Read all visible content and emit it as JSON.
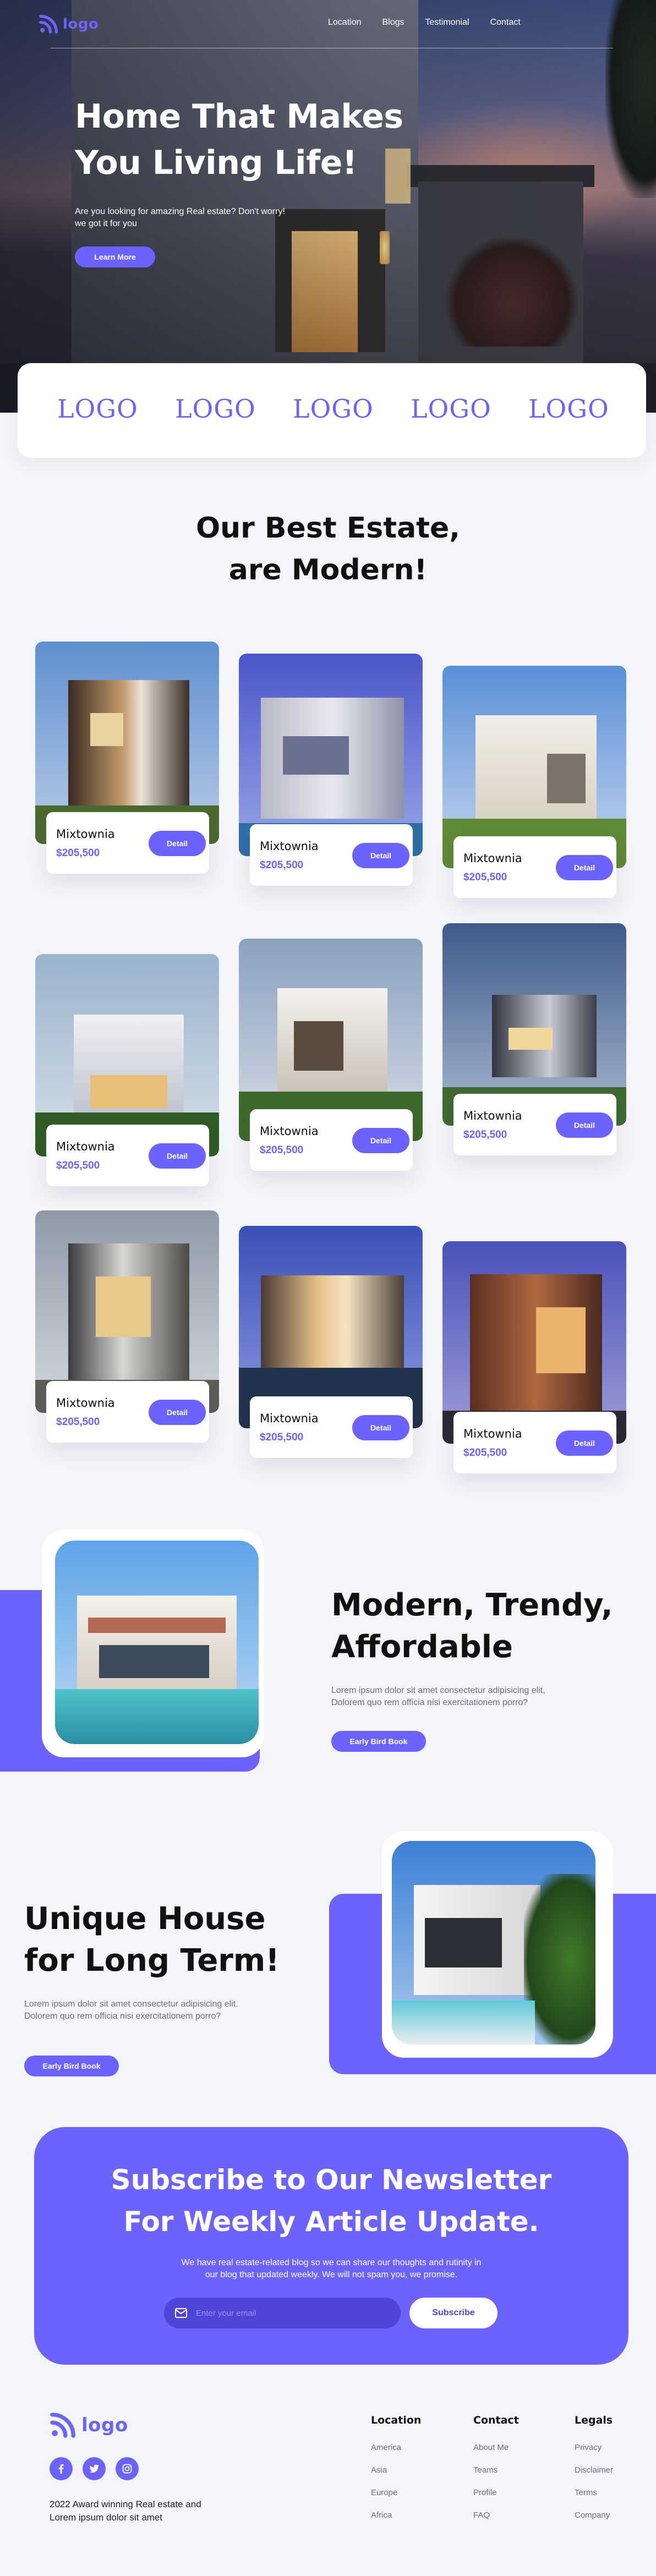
{
  "brand": {
    "name": "logo",
    "accent": "#6c63ff"
  },
  "nav": {
    "items": [
      "Location",
      "Blogs",
      "Testimonial",
      "Contact"
    ]
  },
  "hero": {
    "title_line1": "Home That Makes",
    "title_line2": "You Living Life!",
    "subtitle": "Are you looking for amazing Real estate? Don't worry! we got it for you",
    "cta": "Learn More"
  },
  "partners": [
    "LOGO",
    "LOGO",
    "LOGO",
    "LOGO",
    "LOGO"
  ],
  "estates": {
    "title_line1": "Our Best Estate,",
    "title_line2": "are Modern!",
    "cards": [
      {
        "name": "Mixtownia",
        "price": "$205,500",
        "button": "Detail"
      },
      {
        "name": "Mixtownia",
        "price": "$205,500",
        "button": "Detail"
      },
      {
        "name": "Mixtownia",
        "price": "$205,500",
        "button": "Detail"
      },
      {
        "name": "Mixtownia",
        "price": "$205,500",
        "button": "Detail"
      },
      {
        "name": "Mixtownia",
        "price": "$205,500",
        "button": "Detail"
      },
      {
        "name": "Mixtownia",
        "price": "$205,500",
        "button": "Detail"
      },
      {
        "name": "Mixtownia",
        "price": "$205,500",
        "button": "Detail"
      },
      {
        "name": "Mixtownia",
        "price": "$205,500",
        "button": "Detail"
      },
      {
        "name": "Mixtownia",
        "price": "$205,500",
        "button": "Detail"
      }
    ]
  },
  "feature1": {
    "title_line1": "Modern, Trendy,",
    "title_line2": "Affordable",
    "text": "Lorem ipsum dolor sit amet consectetur adipisicing elit, Dolorem quo rem officia nisi exercitationem porro?",
    "cta": "Early Bird Book"
  },
  "feature2": {
    "title_line1": "Unique House",
    "title_line2": "for Long Term!",
    "text": "Lorem ipsum dolor sit amet consectetur adipisicing elit. Dolorem quo rem officia nisi exercitationem porro?",
    "cta": "Early Bird Book"
  },
  "newsletter": {
    "title_line1": "Subscribe to Our Newsletter",
    "title_line2": "For Weekly Article Update.",
    "text_line1": "We have real estate-related blog so we can share our thoughts and rutinity in",
    "text_line2": "our blog that updated weekly. We will not spam you, we promise.",
    "placeholder": "Enter your email",
    "button": "Subscribe"
  },
  "footer": {
    "logo": "logo",
    "tagline": "2022 Award winning Real estate and Lorem ipsum dolor sit amet",
    "socials": [
      "facebook-icon",
      "twitter-icon",
      "instagram-icon"
    ],
    "columns": [
      {
        "title": "Location",
        "links": [
          "America",
          "Asia",
          "Europe",
          "Africa"
        ]
      },
      {
        "title": "Contact",
        "links": [
          "About Me",
          "Teams",
          "Profile",
          "FAQ"
        ]
      },
      {
        "title": "Legals",
        "links": [
          "Privacy",
          "Disclaimer",
          "Terms",
          "Company"
        ]
      }
    ]
  }
}
